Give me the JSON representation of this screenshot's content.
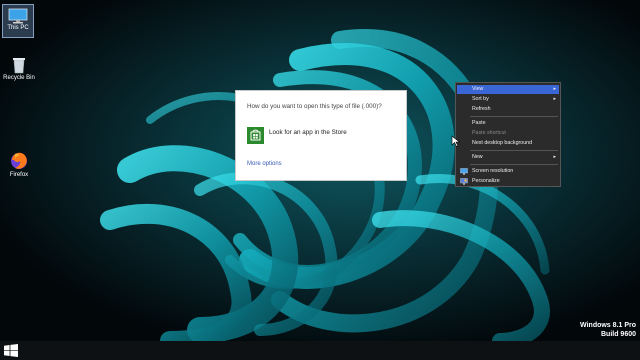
{
  "desktop": {
    "icons": [
      {
        "label": "This PC",
        "icon": "computer-icon"
      },
      {
        "label": "Recycle Bin",
        "icon": "recycle-bin-icon"
      },
      {
        "label": "Firefox",
        "icon": "firefox-icon"
      }
    ]
  },
  "dialog": {
    "title": "How do you want to open this type of file (.000)?",
    "store_option": "Look for an app in the Store",
    "more_options": "More options"
  },
  "context_menu": {
    "items": [
      {
        "label": "View",
        "submenu": true,
        "highlighted": true
      },
      {
        "label": "Sort by",
        "submenu": true
      },
      {
        "label": "Refresh"
      },
      {
        "label": "Paste"
      },
      {
        "label": "Paste shortcut",
        "disabled": true
      },
      {
        "label": "Next desktop background"
      },
      {
        "label": "New",
        "submenu": true
      },
      {
        "label": "Screen resolution",
        "icon": "display-icon"
      },
      {
        "label": "Personalize",
        "icon": "personalize-icon"
      }
    ],
    "submenu_arrow": "▸"
  },
  "watermark": {
    "line1": "Windows 8.1 Pro",
    "line2": "Build 9600"
  },
  "colors": {
    "accent": "#3b66d6",
    "store_green": "#2c8a2e",
    "wallpaper_teal": "#1fc8d8"
  }
}
